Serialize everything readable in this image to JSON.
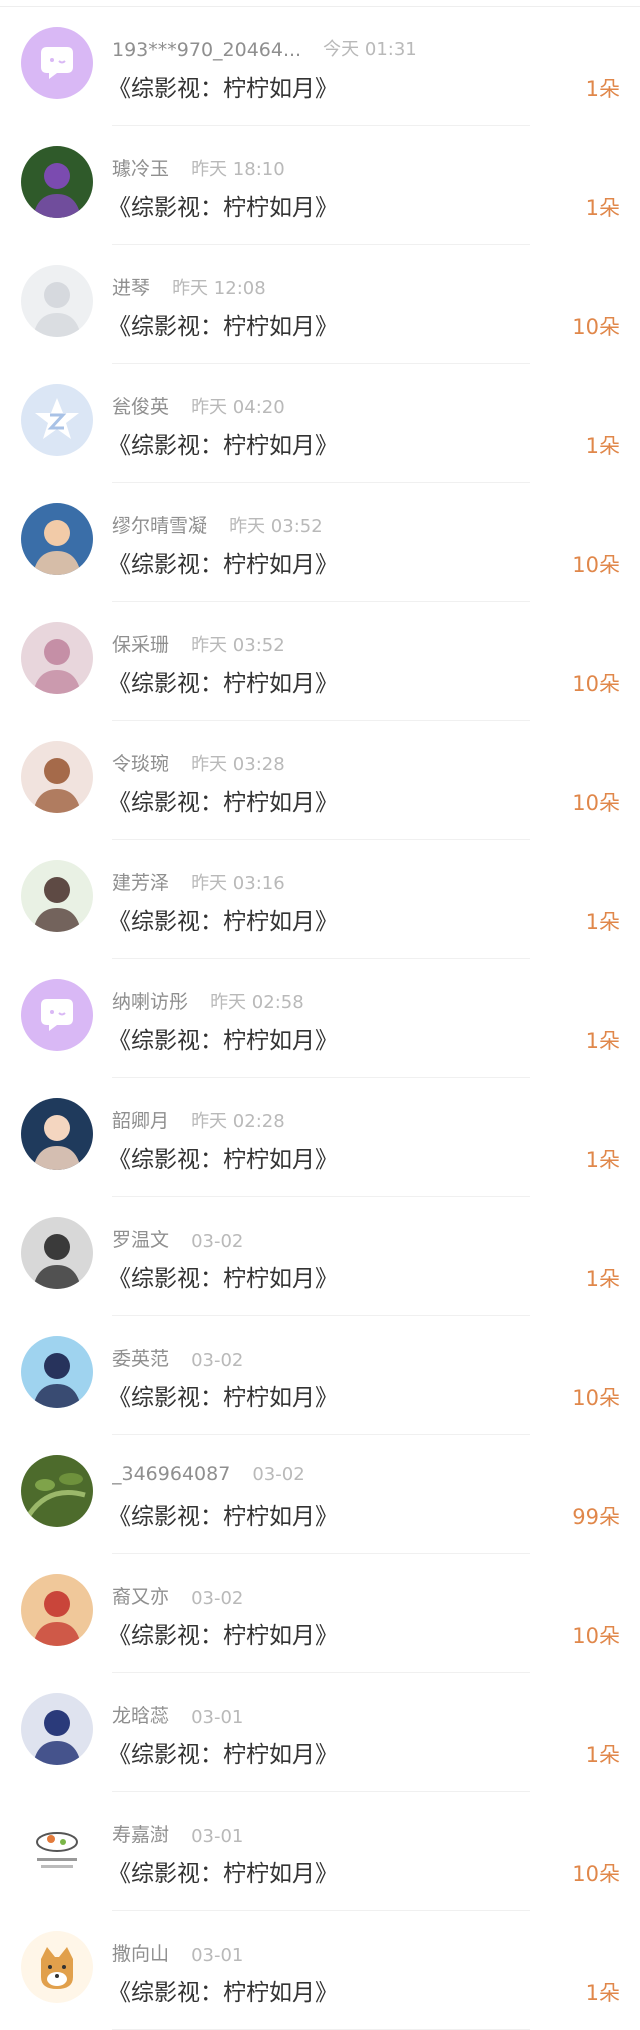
{
  "accent_color": "#e0874a",
  "items": [
    {
      "name": "193***970_20464...",
      "time": "今天 01:31",
      "title": "《综影视：柠柠如月》",
      "count": "1朵",
      "avatar": "chat-bubble-avatar",
      "bg": "#d9b8f5",
      "fg": "#ffffff"
    },
    {
      "name": "璩冷玉",
      "time": "昨天 18:10",
      "title": "《综影视：柠柠如月》",
      "count": "1朵",
      "avatar": "game-character-avatar",
      "bg": "#2f5a2a",
      "fg": "#7b4bb0"
    },
    {
      "name": "进琴",
      "time": "昨天 12:08",
      "title": "《综影视：柠柠如月》",
      "count": "10朵",
      "avatar": "anime-girl-avatar",
      "bg": "#eef0f2",
      "fg": "#d6d9de"
    },
    {
      "name": "瓮俊英",
      "time": "昨天 04:20",
      "title": "《综影视：柠柠如月》",
      "count": "1朵",
      "avatar": "z-star-avatar",
      "bg": "#dbe6f5",
      "fg": "#ffffff"
    },
    {
      "name": "缪尔晴雪凝",
      "time": "昨天 03:52",
      "title": "《综影视：柠柠如月》",
      "count": "10朵",
      "avatar": "boy-photo-avatar",
      "bg": "#3a6ea8",
      "fg": "#f2cba8"
    },
    {
      "name": "保采珊",
      "time": "昨天 03:52",
      "title": "《综影视：柠柠如月》",
      "count": "10朵",
      "avatar": "balloons-avatar",
      "bg": "#e8d6dc",
      "fg": "#c58fa6"
    },
    {
      "name": "令琰琬",
      "time": "昨天 03:28",
      "title": "《综影视：柠柠如月》",
      "count": "10朵",
      "avatar": "girl-photo-avatar",
      "bg": "#f1e3de",
      "fg": "#a56a4a"
    },
    {
      "name": "建芳泽",
      "time": "昨天 03:16",
      "title": "《综影视：柠柠如月》",
      "count": "1朵",
      "avatar": "girl-garden-avatar",
      "bg": "#e9f1e4",
      "fg": "#5e4a44"
    },
    {
      "name": "纳喇访彤",
      "time": "昨天 02:58",
      "title": "《综影视：柠柠如月》",
      "count": "1朵",
      "avatar": "chat-bubble-avatar",
      "bg": "#d9b8f5",
      "fg": "#ffffff"
    },
    {
      "name": "韶卿月",
      "time": "昨天 02:28",
      "title": "《综影视：柠柠如月》",
      "count": "1朵",
      "avatar": "girl-bow-avatar",
      "bg": "#1f3a5c",
      "fg": "#f4d6c0"
    },
    {
      "name": "罗温文",
      "time": "03-02",
      "title": "《综影视：柠柠如月》",
      "count": "1朵",
      "avatar": "dark-figure-avatar",
      "bg": "#d8d8d8",
      "fg": "#3a3a3a"
    },
    {
      "name": "委英范",
      "time": "03-02",
      "title": "《综影视：柠柠如月》",
      "count": "10朵",
      "avatar": "cartoon-avatar",
      "bg": "#9fd3ef",
      "fg": "#27335c"
    },
    {
      "name": "_346964087",
      "time": "03-02",
      "title": "《综影视：柠柠如月》",
      "count": "99朵",
      "avatar": "plant-photo-avatar",
      "bg": "#4d6b2c",
      "fg": "#9bb86a"
    },
    {
      "name": "裔又亦",
      "time": "03-02",
      "title": "《综影视：柠柠如月》",
      "count": "10朵",
      "avatar": "family-photo-avatar",
      "bg": "#f0c89a",
      "fg": "#c9453a"
    },
    {
      "name": "龙晗蕊",
      "time": "03-01",
      "title": "《综影视：柠柠如月》",
      "count": "1朵",
      "avatar": "anime-boy-avatar",
      "bg": "#dfe3ef",
      "fg": "#2a3a7a"
    },
    {
      "name": "寿嘉澍",
      "time": "03-01",
      "title": "《综影视：柠柠如月》",
      "count": "10朵",
      "avatar": "sketch-food-avatar",
      "bg": "#ffffff",
      "fg": "#e37b3b"
    },
    {
      "name": "撒向山",
      "time": "03-01",
      "title": "《综影视：柠柠如月》",
      "count": "1朵",
      "avatar": "shiba-dog-avatar",
      "bg": "#fff6e8",
      "fg": "#e1a04c"
    }
  ]
}
